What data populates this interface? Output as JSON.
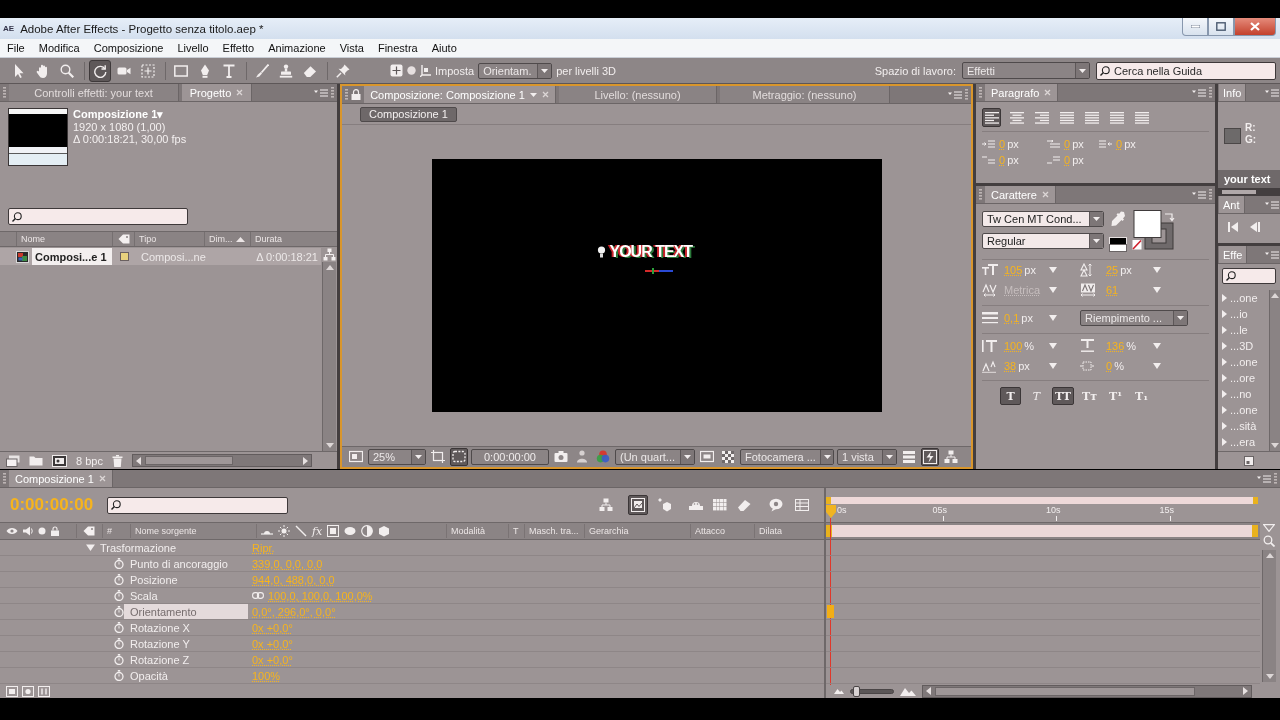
{
  "window": {
    "app_badge": "AE",
    "title": "Adobe After Effects - Progetto senza titolo.aep *"
  },
  "menu": [
    "File",
    "Modifica",
    "Composizione",
    "Livello",
    "Effetto",
    "Animazione",
    "Vista",
    "Finestra",
    "Aiuto"
  ],
  "toolbar": {
    "tools": [
      {
        "selected": false
      },
      {
        "selected": false
      },
      {
        "selected": false
      },
      {
        "selected": true
      },
      {
        "selected": false
      },
      {
        "selected": false
      },
      {
        "selected": false
      },
      {
        "selected": false
      },
      {
        "selected": false
      },
      {
        "selected": false
      },
      {
        "selected": false
      },
      {
        "selected": false
      },
      {
        "selected": false
      }
    ],
    "orient_label": "Imposta",
    "orient_value": "Orientam.",
    "orient_suffix": "per livelli 3D",
    "workspace_label": "Spazio di lavoro:",
    "workspace_value": "Effetti",
    "help_search": {
      "placeholder": "Cerca nella Guida"
    }
  },
  "project_panel": {
    "tabs": [
      {
        "label": "Controlli effetti: your text",
        "selected": false
      },
      {
        "label": "Progetto",
        "selected": true
      }
    ],
    "comp_name": "Composizione 1▾",
    "comp_size": "1920 x 1080 (1,00)",
    "comp_duration": "Δ 0:00:18:21, 30,00 fps",
    "columns": [
      "Nome",
      "Tipo",
      "Dim...",
      "Durata"
    ],
    "items": [
      {
        "name": "Composi...e 1",
        "type": "Composi...ne",
        "duration": "Δ 0:00:18:21",
        "color": "#e8d27e",
        "selected": true
      }
    ],
    "bit_depth": "8 bpc"
  },
  "viewer": {
    "tabs": [
      {
        "label": "Composizione: Composizione 1",
        "selected": true
      },
      {
        "label": "Livello: (nessuno)",
        "selected": false
      },
      {
        "label": "Metraggio: (nessuno)",
        "selected": false
      }
    ],
    "breadcrumb": "Composizione 1",
    "canvas_text": "YOUR TEXT",
    "zoom": "25%",
    "time": "0:00:00:00",
    "resolution": "(Un quart...",
    "camera": "Fotocamera ...",
    "views": "1 vista",
    "toggles": [
      {
        "selected": false
      },
      {
        "selected": false
      },
      {
        "selected": true
      },
      {
        "selected": false
      },
      {
        "selected": false
      },
      {
        "selected": false
      },
      {
        "selected": false
      },
      {
        "selected": false
      },
      {
        "selected": false
      },
      {
        "selected": true
      },
      {
        "selected": false
      }
    ]
  },
  "paragraph_panel": {
    "tab": "Paragrafo",
    "align": [
      {
        "selected": true
      },
      {
        "selected": false
      },
      {
        "selected": false
      },
      {
        "selected": false
      },
      {
        "selected": false
      },
      {
        "selected": false
      },
      {
        "selected": false
      }
    ],
    "indents": [
      {
        "value": "0",
        "unit": "px"
      },
      {
        "value": "0",
        "unit": "px"
      },
      {
        "value": "0",
        "unit": "px"
      },
      {
        "value": "0",
        "unit": "px"
      },
      {
        "value": "0",
        "unit": "px"
      }
    ]
  },
  "character_panel": {
    "tab": "Carattere",
    "font": "Tw Cen MT Cond...",
    "style": "Regular",
    "metrics": [
      {
        "value": "105",
        "unit": "px",
        "disabled": false
      },
      {
        "value": "25",
        "unit": "px",
        "disabled": false
      },
      {
        "value": "Metrica",
        "disabled": true
      },
      {
        "value": "61",
        "disabled": false
      }
    ],
    "stroke": {
      "value": "0,1",
      "unit": "px"
    },
    "stroke_mode": "Riempimento ...",
    "scales": [
      {
        "value": "100",
        "unit": "%"
      },
      {
        "value": "136",
        "unit": "%"
      },
      {
        "value": "38",
        "unit": "px"
      },
      {
        "value": "0",
        "unit": "%"
      }
    ],
    "styles": [
      {
        "label": "T",
        "kind": "bold",
        "selected": true
      },
      {
        "label": "T",
        "kind": "italic",
        "selected": false
      },
      {
        "label": "TT",
        "kind": "caps",
        "selected": true
      },
      {
        "label": "Tᴛ",
        "kind": "small_caps",
        "selected": false
      },
      {
        "label": "T¹",
        "kind": "superscript",
        "selected": false
      },
      {
        "label": "T₁",
        "kind": "subscript",
        "selected": false
      }
    ]
  },
  "info_panel": {
    "tab": "Info",
    "readouts": [
      "R:",
      "G:"
    ]
  },
  "layer_label": "your text",
  "preview_panel": {
    "tab": "Ant"
  },
  "effects_panel": {
    "tab": "Effe",
    "items": [
      "...one",
      "...io",
      "...le",
      "...3D",
      "...one",
      "...ore",
      "...no",
      "...one",
      "...sità",
      "...era"
    ]
  },
  "timeline": {
    "tab": "Composizione 1",
    "timecode": "0:00:00:00",
    "switch_buttons": [
      {
        "selected": false
      },
      {
        "selected": true
      },
      {
        "selected": false
      },
      {
        "selected": false
      },
      {
        "selected": false
      },
      {
        "selected": false
      },
      {
        "selected": false
      },
      {
        "selected": false
      }
    ],
    "columns": [
      "#",
      "Nome sorgente",
      "Modalità",
      "T",
      "Masch. tra...",
      "Gerarchia",
      "Attacco",
      "Dilata"
    ],
    "fx_label": "fx",
    "ruler": [
      "0s",
      "05s",
      "10s",
      "15s"
    ],
    "group": {
      "name": "Trasformazione",
      "value": "Ripr.",
      "expanded": true
    },
    "properties": [
      {
        "kind": "property",
        "name": "Punto di ancoraggio",
        "value": "339,0, 0,0, 0,0",
        "selected": false,
        "keyframe": false
      },
      {
        "kind": "property",
        "name": "Posizione",
        "value": "944,0, 488,0, 0,0",
        "selected": false,
        "keyframe": false
      },
      {
        "kind": "linked",
        "name": "Scala",
        "value": "100,0, 100,0, 100,0%",
        "selected": false,
        "keyframe": false
      },
      {
        "kind": "property",
        "name": "Orientamento",
        "value": "0,0°, 296,0°, 0,0°",
        "selected": true,
        "keyframe": true
      },
      {
        "kind": "property",
        "name": "Rotazione X",
        "value": "0x +0,0°",
        "selected": false,
        "keyframe": false
      },
      {
        "kind": "property",
        "name": "Rotazione Y",
        "value": "0x +0,0°",
        "selected": false,
        "keyframe": false
      },
      {
        "kind": "property",
        "name": "Rotazione Z",
        "value": "0x +0,0°",
        "selected": false,
        "keyframe": false
      },
      {
        "kind": "property",
        "name": "Opacità",
        "value": "100%",
        "selected": false,
        "keyframe": false
      }
    ],
    "zoom_slider": {
      "level": 0.05
    }
  }
}
